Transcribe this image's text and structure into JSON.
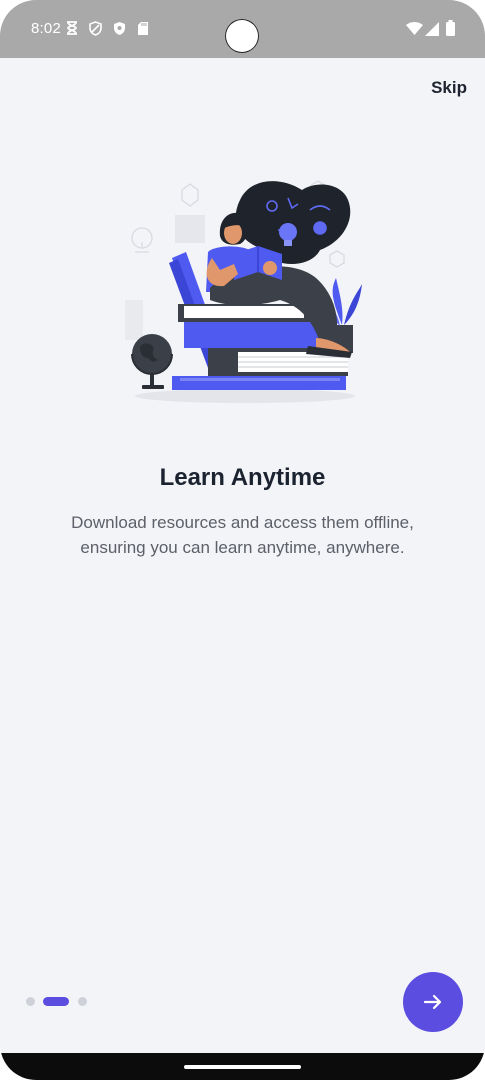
{
  "status_bar": {
    "time": "8:02",
    "icons": [
      "hourglass-icon",
      "shield-icon",
      "security-badge-icon",
      "sd-card-icon",
      "wifi-icon",
      "signal-icon",
      "battery-icon"
    ]
  },
  "onboarding": {
    "skip_label": "Skip",
    "illustration": "woman-reading-on-books-illustration",
    "title": "Learn Anytime",
    "description_line1": "Download resources and access them offline,",
    "description_line2": "ensuring you can learn anytime, anywhere.",
    "page_indicator": {
      "count": 3,
      "active_index": 1
    },
    "next_icon": "arrow-right-icon"
  },
  "colors": {
    "accent": "#5b4de0",
    "background": "#f3f4f8",
    "title": "#1c2330",
    "description": "#5d6068",
    "status_bar": "#a9a9a9"
  }
}
